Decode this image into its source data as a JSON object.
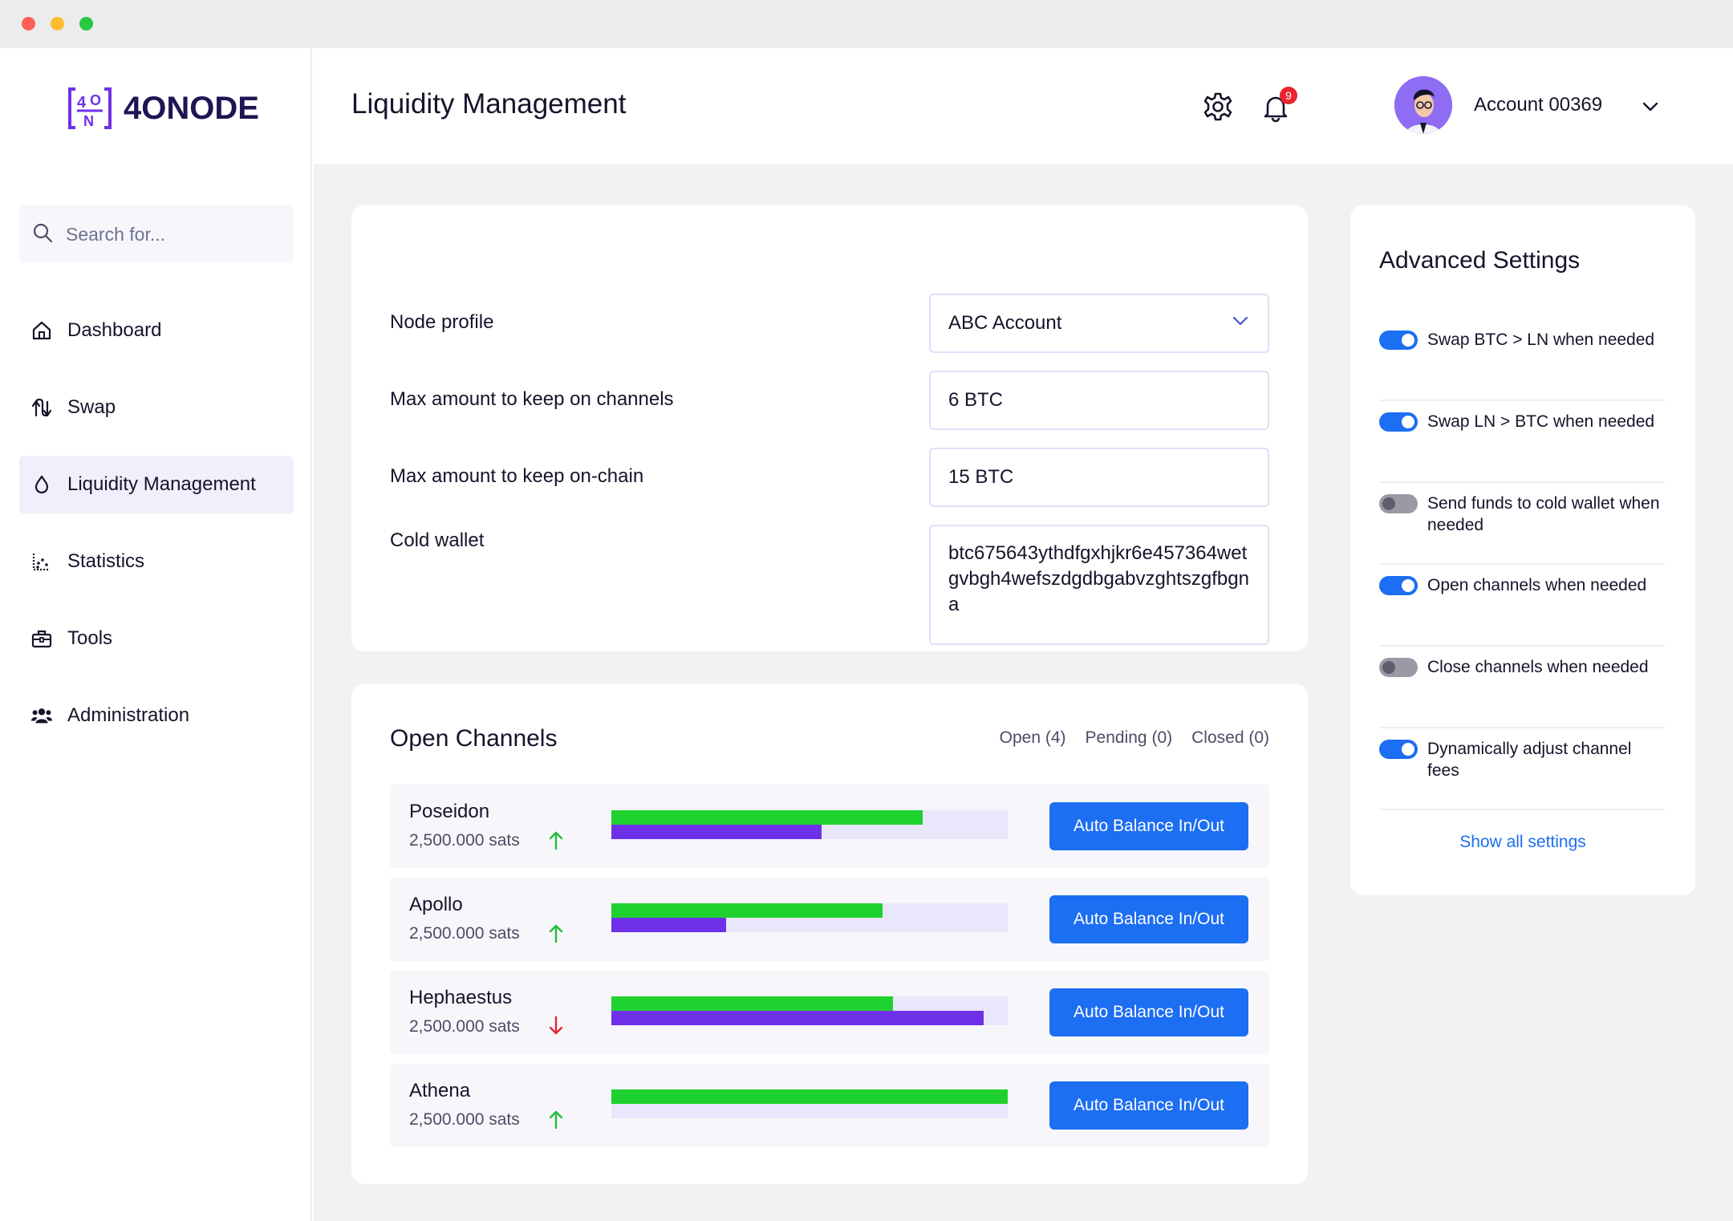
{
  "window": {
    "controls": [
      "close",
      "minimize",
      "zoom"
    ]
  },
  "brand": {
    "name": "4ONODE",
    "mark_text": "4ON",
    "color": "#6f31e8"
  },
  "sidebar": {
    "search_placeholder": "Search for...",
    "items": [
      {
        "label": "Dashboard",
        "icon": "home-icon",
        "active": false
      },
      {
        "label": "Swap",
        "icon": "swap-icon",
        "active": false
      },
      {
        "label": "Liquidity Management",
        "icon": "drop-icon",
        "active": true
      },
      {
        "label": "Statistics",
        "icon": "chart-icon",
        "active": false
      },
      {
        "label": "Tools",
        "icon": "toolbox-icon",
        "active": false
      },
      {
        "label": "Administration",
        "icon": "users-icon",
        "active": false
      }
    ]
  },
  "header": {
    "title": "Liquidity Management",
    "notification_count": "9",
    "account_name": "Account 00369"
  },
  "form": {
    "node_profile_label": "Node profile",
    "node_profile_value": "ABC Account",
    "max_channels_label": "Max amount to keep on channels",
    "max_channels_value": "6 BTC",
    "max_onchain_label": "Max amount to keep on-chain",
    "max_onchain_value": "15 BTC",
    "cold_wallet_label": "Cold wallet",
    "cold_wallet_value": "btc675643ythdfgxhjkr6e457364wetgvbgh4wefszdgdbgabvzghtszgfbgna"
  },
  "channels": {
    "title": "Open Channels",
    "tabs": [
      "Open (4)",
      "Pending (0)",
      "Closed (0)"
    ],
    "button_label": "Auto Balance In/Out",
    "rows": [
      {
        "name": "Poseidon",
        "amount": "2,500.000 sats",
        "trend": "up",
        "outbound": 0.785,
        "inbound": 0.53
      },
      {
        "name": "Apollo",
        "amount": "2,500.000 sats",
        "trend": "up",
        "outbound": 0.685,
        "inbound": 0.29
      },
      {
        "name": "Hephaestus",
        "amount": "2,500.000 sats",
        "trend": "down",
        "outbound": 0.71,
        "inbound": 0.94
      },
      {
        "name": "Athena",
        "amount": "2,500.000 sats",
        "trend": "up",
        "outbound": 1.0,
        "inbound": 0.0
      }
    ]
  },
  "advanced": {
    "title": "Advanced Settings",
    "settings": [
      {
        "label": "Swap BTC > LN when needed",
        "on": true
      },
      {
        "label": "Swap LN > BTC when needed",
        "on": true
      },
      {
        "label": "Send funds to cold wallet when needed",
        "on": false
      },
      {
        "label": "Open channels when needed",
        "on": true
      },
      {
        "label": "Close channels when needed",
        "on": false
      },
      {
        "label": "Dynamically adjust channel fees",
        "on": true
      }
    ],
    "show_all": "Show all settings"
  },
  "colors": {
    "accent": "#1c6ef2",
    "outbound_bar": "#1fd12f",
    "inbound_bar": "#6f31e8",
    "trend_up": "#1fbf3a",
    "trend_down": "#e8262e"
  }
}
